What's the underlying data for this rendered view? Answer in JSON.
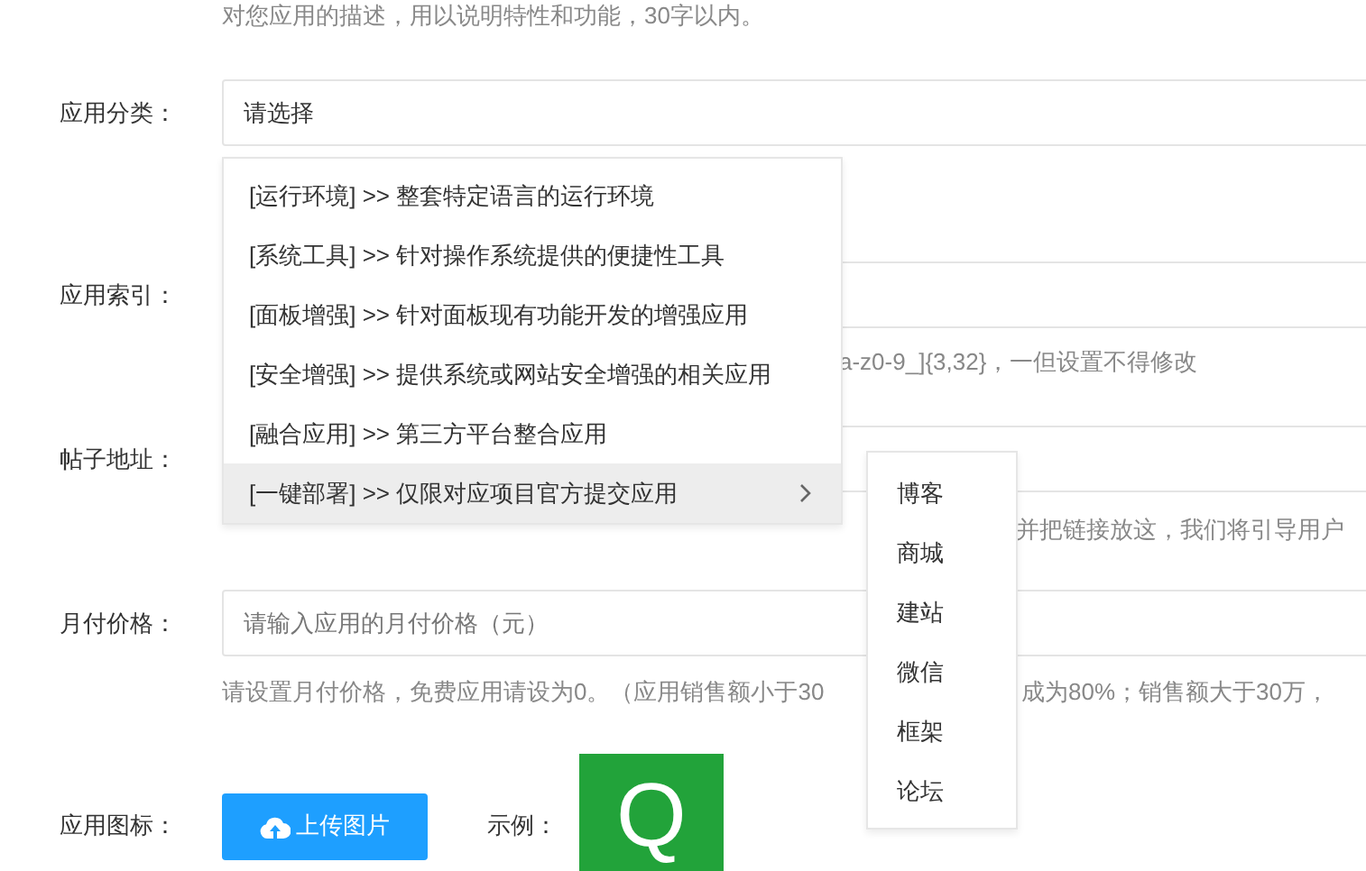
{
  "description_help": "对您应用的描述，用以说明特性和功能，30字以内。",
  "category": {
    "label": "应用分类：",
    "placeholder": "请选择"
  },
  "index": {
    "label": "应用索引：",
    "help": "a-z0-9_]{3,32}，一但设置不得修改"
  },
  "post_url": {
    "label": "帖子地址：",
    "help": "并把链接放这，我们将引导用户"
  },
  "price": {
    "label": "月付价格：",
    "placeholder": "请输入应用的月付价格（元）",
    "help": [
      "请设置月付价格，免费应用请设为0。（应用销售额小于30",
      "成为80%；销售额大于30万，"
    ]
  },
  "icon": {
    "label": "应用图标：",
    "upload_button": "上传图片",
    "example_label": "示例：",
    "example_letter": "Q"
  },
  "menu": [
    {
      "label": "[运行环境] >> 整套特定语言的运行环境",
      "kind": "leaf",
      "selected": false
    },
    {
      "label": "[系统工具] >> 针对操作系统提供的便捷性工具",
      "kind": "leaf",
      "selected": false
    },
    {
      "label": "[面板增强] >> 针对面板现有功能开发的增强应用",
      "kind": "leaf",
      "selected": false
    },
    {
      "label": "[安全增强] >> 提供系统或网站安全增强的相关应用",
      "kind": "leaf",
      "selected": false
    },
    {
      "label": "[融合应用] >> 第三方平台整合应用",
      "kind": "leaf",
      "selected": false
    },
    {
      "label": "[一键部署] >> 仅限对应项目官方提交应用",
      "kind": "parent",
      "selected": true
    }
  ],
  "submenu": [
    {
      "label": "博客"
    },
    {
      "label": "商城"
    },
    {
      "label": "建站"
    },
    {
      "label": "微信"
    },
    {
      "label": "框架"
    },
    {
      "label": "论坛"
    }
  ]
}
